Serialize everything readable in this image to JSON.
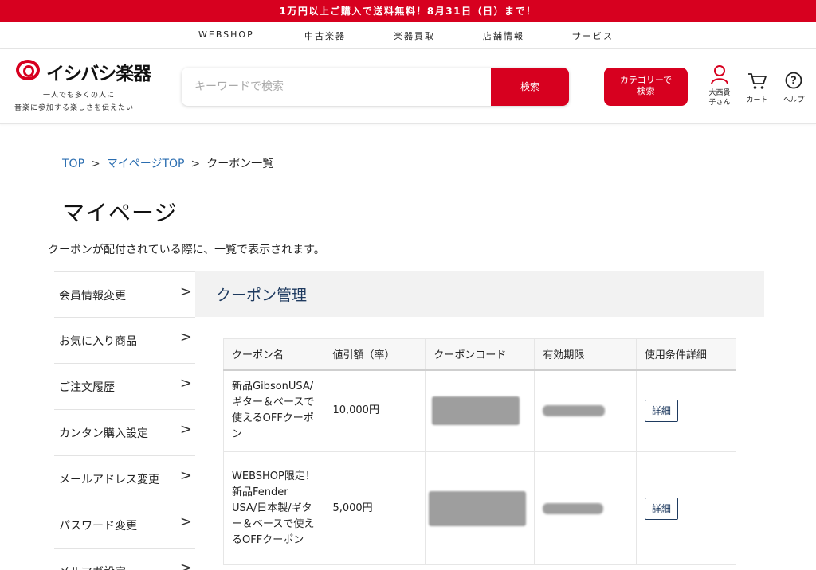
{
  "banner": {
    "text": "1万円以上ご購入で送料無料！8月31日（日）まで！"
  },
  "topnav": [
    "WEBSHOP",
    "中古楽器",
    "楽器買取",
    "店舗情報",
    "サービス"
  ],
  "header": {
    "logo_text": "イシバシ楽器",
    "tagline_1": "一人でも多くの人に",
    "tagline_2": "音楽に参加する楽しさを伝えたい",
    "search_placeholder": "キーワードで検索",
    "search_button": "検索",
    "category_button_1": "カテゴリーで",
    "category_button_2": "検索",
    "user_name_1": "大西貴",
    "user_name_2": "子さん",
    "cart_label": "カート",
    "help_label": "ヘルプ"
  },
  "breadcrumb": {
    "items": [
      "TOP",
      "マイページTOP",
      "クーポン一覧"
    ],
    "separator": ">"
  },
  "page_title": "マイページ",
  "lead_text": "クーポンが配付されている際に、一覧で表示されます。",
  "side_menu": [
    {
      "label": "会員情報変更",
      "arrow": ">"
    },
    {
      "label": "お気に入り商品",
      "arrow": ">"
    },
    {
      "label": "ご注文履歴",
      "arrow": ">"
    },
    {
      "label": "カンタン購入設定",
      "arrow": ">"
    },
    {
      "label": "メールアドレス変更",
      "arrow": ">"
    },
    {
      "label": "パスワード変更",
      "arrow": ">"
    },
    {
      "label": "メルマガ設定",
      "arrow": ">"
    }
  ],
  "panel_title": "クーポン管理",
  "coupon_table": {
    "headers": [
      "クーポン名",
      "値引額（率）",
      "クーポンコード",
      "有効期限",
      "使用条件詳細"
    ],
    "rows": [
      {
        "name": "新品GibsonUSA/ギター＆ベースで使えるOFFクーポン",
        "amount": "10,000円",
        "detail": "詳細"
      },
      {
        "name": "WEBSHOP限定！新品Fender USA/日本製/ギター＆ベースで使えるOFFクーポン",
        "amount": "5,000円",
        "detail": "詳細"
      }
    ]
  },
  "colors": {
    "brand_red": "#d7001f",
    "link_blue": "#2a6db0",
    "navy": "#1e3a5f"
  }
}
